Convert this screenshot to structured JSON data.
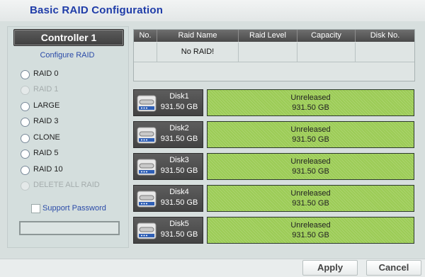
{
  "title": "Basic RAID Configuration",
  "controller": {
    "label": "Controller 1"
  },
  "configure": {
    "label": "Configure RAID",
    "options": [
      {
        "label": "RAID 0",
        "disabled": false
      },
      {
        "label": "RAID 1",
        "disabled": true
      },
      {
        "label": "LARGE",
        "disabled": false
      },
      {
        "label": "RAID 3",
        "disabled": false
      },
      {
        "label": "CLONE",
        "disabled": false
      },
      {
        "label": "RAID 5",
        "disabled": false
      },
      {
        "label": "RAID 10",
        "disabled": false
      },
      {
        "label": "DELETE ALL RAID",
        "disabled": true
      }
    ],
    "password_label": "Support Password",
    "password_value": ""
  },
  "raid_table": {
    "headers": [
      "No.",
      "Raid Name",
      "Raid Level",
      "Capacity",
      "Disk No."
    ],
    "rows": [
      [
        "",
        "No RAID!",
        "",
        "",
        ""
      ]
    ]
  },
  "disks": [
    {
      "name": "Disk1",
      "size": "931.50 GB",
      "status": "Unreleased",
      "status_size": "931.50 GB"
    },
    {
      "name": "Disk2",
      "size": "931.50 GB",
      "status": "Unreleased",
      "status_size": "931.50 GB"
    },
    {
      "name": "Disk3",
      "size": "931.50 GB",
      "status": "Unreleased",
      "status_size": "931.50 GB"
    },
    {
      "name": "Disk4",
      "size": "931.50 GB",
      "status": "Unreleased",
      "status_size": "931.50 GB"
    },
    {
      "name": "Disk5",
      "size": "931.50 GB",
      "status": "Unreleased",
      "status_size": "931.50 GB"
    }
  ],
  "footer": {
    "apply": "Apply",
    "cancel": "Cancel"
  },
  "colors": {
    "title": "#1f3ca8",
    "unreleased": "#9ccc56",
    "tile": "#4a4a4a"
  },
  "icons": {
    "disk": "hard-drive-icon"
  }
}
